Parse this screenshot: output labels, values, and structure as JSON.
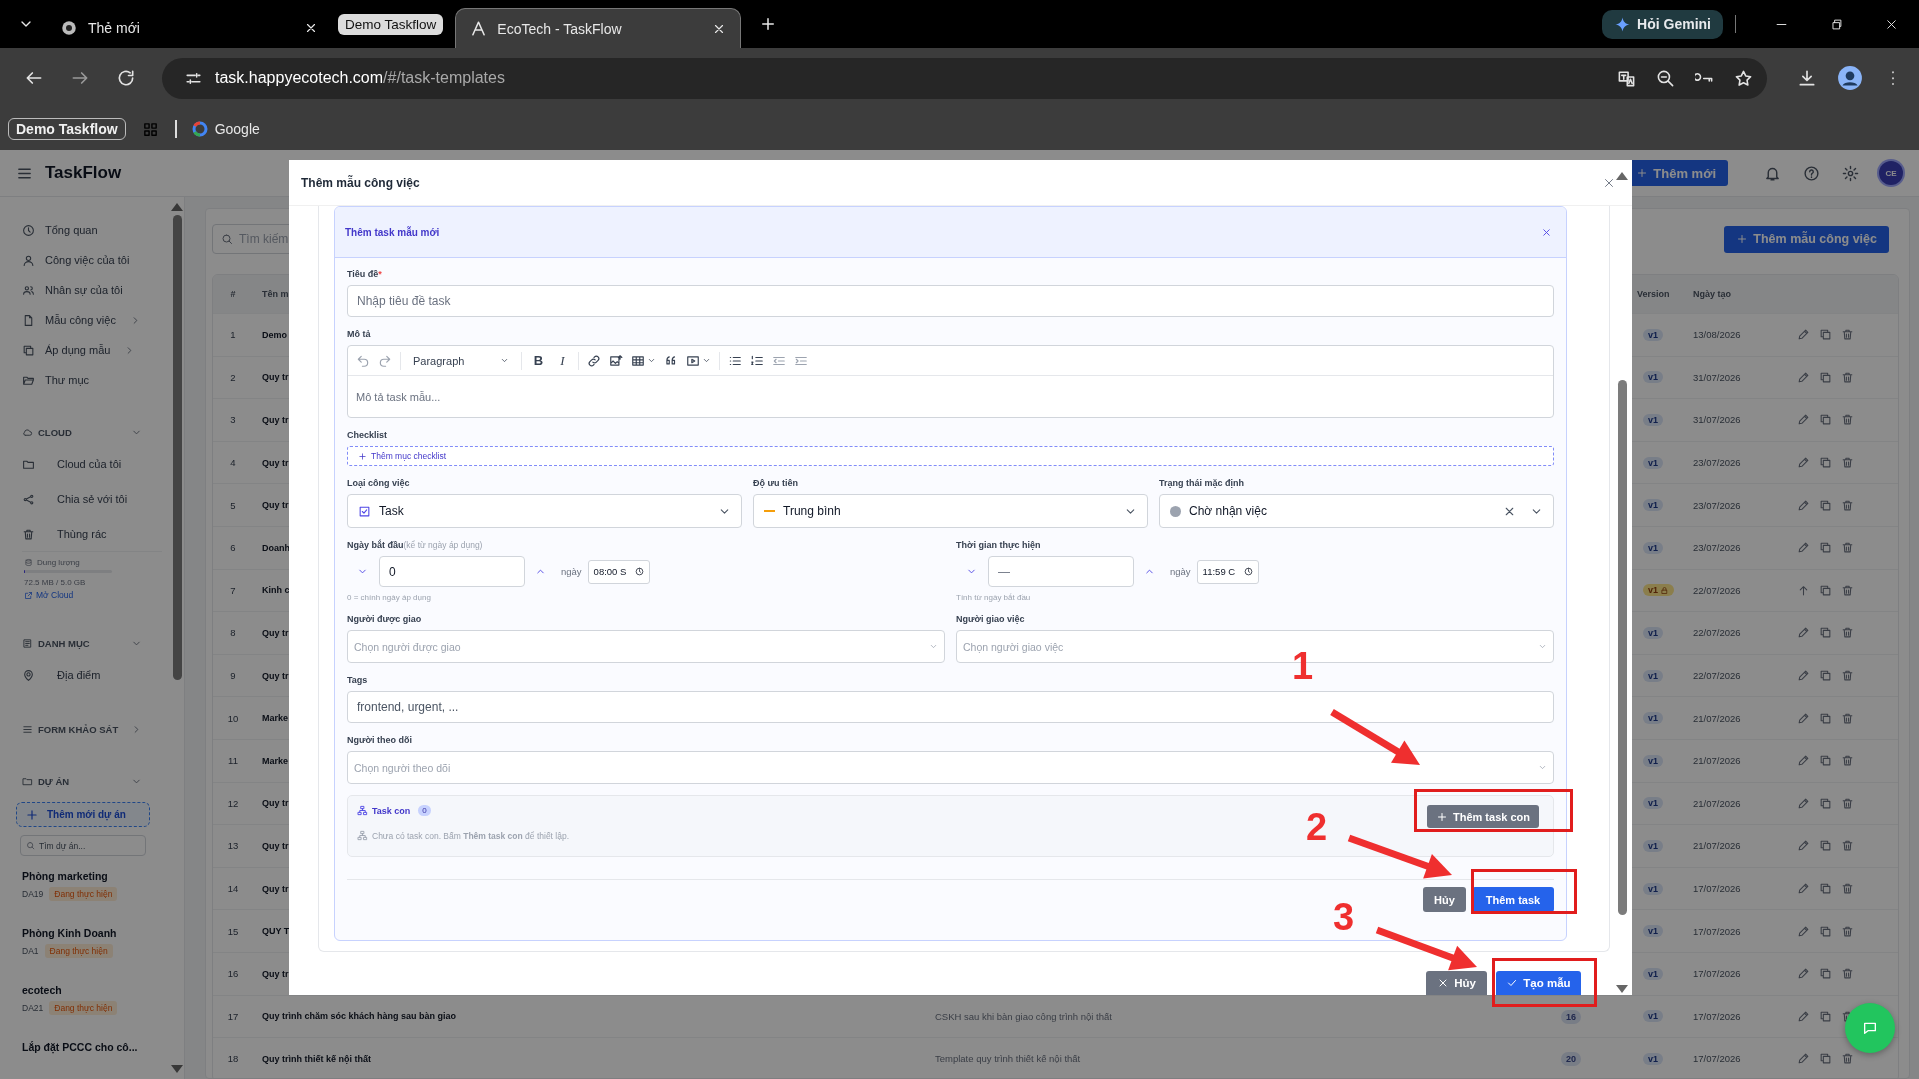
{
  "browser": {
    "tabs": [
      {
        "title": "Thẻ mới",
        "selected": false
      },
      {
        "title": "EcoTech - TaskFlow",
        "selected": true
      }
    ],
    "tab_group": "Demo Taskflow",
    "gemini": "Hỏi Gemini",
    "url_host": "task.happyecotech.com",
    "url_path": "/#/task-templates",
    "bookmarks": [
      {
        "label": "Demo Taskflow",
        "kind": "chip"
      },
      {
        "label": "Google",
        "kind": "link"
      }
    ]
  },
  "header": {
    "brand": "TaskFlow",
    "add_button": "Thêm mới",
    "avatar": "CE"
  },
  "sidebar": {
    "nav": [
      {
        "label": "Tổng quan",
        "has_submenu": false
      },
      {
        "label": "Công việc của tôi",
        "has_submenu": false
      },
      {
        "label": "Nhân sự của tôi",
        "has_submenu": false
      },
      {
        "label": "Mẫu công việc",
        "has_submenu": true
      },
      {
        "label": "Áp dụng mẫu",
        "has_submenu": true
      },
      {
        "label": "Thư mục",
        "has_submenu": false
      }
    ],
    "cloud": {
      "title": "CLOUD",
      "expanded": true,
      "items": [
        "Cloud của tôi",
        "Chia sẻ với tôi",
        "Thùng rác"
      ],
      "storage_label": "Dung lượng",
      "level": 0.015,
      "usage": "72.5 MB / 5.0 GB",
      "open_link": "Mở Cloud"
    },
    "categories": {
      "title": "DANH MỤC",
      "expanded": true,
      "items": [
        "Địa điểm"
      ]
    },
    "survey": {
      "title": "FORM KHẢO SÁT",
      "expanded": false
    },
    "projects": {
      "title": "DỰ ÁN",
      "expanded": true,
      "add_button": "Thêm mới dự án",
      "search_placeholder": "Tìm dự án...",
      "items": [
        {
          "name": "Phòng marketing",
          "code": "DA19",
          "status": "Đang thực hiện"
        },
        {
          "name": "Phòng Kinh Doanh",
          "code": "DA1",
          "status": "Đang thực hiện"
        },
        {
          "name": "ecotech",
          "code": "DA21",
          "status": "Đang thực hiện"
        },
        {
          "name": "Lắp đặt PCCC cho cô..."
        }
      ]
    }
  },
  "page": {
    "search_placeholder": "Tìm kiếm",
    "create_button": "Thêm mẫu công việc",
    "columns": {
      "index": "#",
      "name": "Tên m",
      "version": "Version",
      "date": "Ngày tạo"
    },
    "rows": [
      {
        "index": "1",
        "name": "Demo",
        "version": "v1",
        "date": "13/08/2026",
        "locked": false
      },
      {
        "index": "2",
        "name": "Quy tr",
        "version": "v1",
        "date": "31/07/2026",
        "locked": false
      },
      {
        "index": "3",
        "name": "Quy tr",
        "version": "v1",
        "date": "31/07/2026",
        "locked": false
      },
      {
        "index": "4",
        "name": "Quy tr",
        "version": "v1",
        "date": "23/07/2026",
        "locked": false
      },
      {
        "index": "5",
        "name": "Quy tr",
        "version": "v1",
        "date": "23/07/2026",
        "locked": false
      },
      {
        "index": "6",
        "name": "Doanh",
        "version": "v1",
        "date": "23/07/2026",
        "locked": false
      },
      {
        "index": "7",
        "name": "Kinh c",
        "version": "v1",
        "date": "22/07/2026",
        "locked": true
      },
      {
        "index": "8",
        "name": "Quy tr",
        "version": "v1",
        "date": "22/07/2026",
        "locked": false
      },
      {
        "index": "9",
        "name": "Quy tr",
        "version": "v1",
        "date": "22/07/2026",
        "locked": false
      },
      {
        "index": "10",
        "name": "Marke",
        "version": "v1",
        "date": "21/07/2026",
        "locked": false
      },
      {
        "index": "11",
        "name": "Marke",
        "version": "v1",
        "date": "21/07/2026",
        "locked": false
      },
      {
        "index": "12",
        "name": "Quy tr",
        "version": "v1",
        "date": "21/07/2026",
        "locked": false
      },
      {
        "index": "13",
        "name": "Quy tr",
        "version": "v1",
        "date": "21/07/2026",
        "locked": false
      },
      {
        "index": "14",
        "name": "Quy tr",
        "version": "v1",
        "date": "17/07/2026",
        "locked": false
      },
      {
        "index": "15",
        "name": "QUY T",
        "version": "v1",
        "date": "17/07/2026",
        "locked": false
      },
      {
        "index": "16",
        "name": "Quy tr",
        "version": "v1",
        "date": "17/07/2026",
        "locked": false
      },
      {
        "index": "17",
        "name": "Quy trình chăm sóc khách hàng sau bàn giao",
        "description": "CSKH sau khi bàn giao công trình nội thất",
        "count": "16",
        "version": "v1",
        "date": "17/07/2026",
        "locked": false
      },
      {
        "index": "18",
        "name": "Quy trình thiết kế nội thất",
        "description": "Template quy trình thiết kế nội thất",
        "count": "20",
        "version": "v1",
        "date": "17/07/2026",
        "locked": false
      }
    ]
  },
  "modal": {
    "title": "Thêm mẫu công việc",
    "card_title": "Thêm task mẫu mới",
    "title_field": {
      "label": "Tiêu đề",
      "required_mark": "*",
      "placeholder": "Nhập tiêu đề task"
    },
    "description": {
      "label": "Mô tả",
      "bold": "B",
      "italic": "I",
      "block_format": "Paragraph",
      "placeholder": "Mô tả task mẫu..."
    },
    "checklist": {
      "label": "Checklist",
      "add_button": "Thêm mục checklist"
    },
    "type": {
      "label": "Loại công việc",
      "value": "Task"
    },
    "priority": {
      "label": "Độ ưu tiên",
      "value": "Trung bình"
    },
    "status": {
      "label": "Trạng thái mặc định",
      "value": "Chờ nhận việc"
    },
    "start": {
      "label": "Ngày bắt đầu",
      "note": "(kể từ ngày áp dụng)",
      "value": "0",
      "unit": "ngày",
      "time": "08:00 S",
      "hint": "0 = chính ngày áp dụng"
    },
    "duration": {
      "label": "Thời gian thực hiện",
      "placeholder": "—",
      "unit": "ngày",
      "time": "11:59 C",
      "hint": "Tính từ ngày bắt đầu"
    },
    "assignee": {
      "label": "Người được giao",
      "placeholder": "Chọn người được giao"
    },
    "assigner": {
      "label": "Người giao việc",
      "placeholder": "Chọn người giao việc"
    },
    "tags": {
      "label": "Tags",
      "placeholder": "frontend, urgent, ..."
    },
    "followers": {
      "label": "Người theo dõi",
      "placeholder": "Chọn người theo dõi"
    },
    "subtasks": {
      "label": "Task con",
      "count": "0",
      "empty_text": "Chưa có task con. Bấm **Thêm task con** để thiết lập.",
      "add_button": "Thêm task con"
    },
    "card_cancel": "Hủy",
    "card_submit": "Thêm task",
    "cancel": "Hủy",
    "submit": "Tạo mẫu"
  },
  "annotations": [
    {
      "label": "1"
    },
    {
      "label": "2"
    },
    {
      "label": "3"
    }
  ]
}
